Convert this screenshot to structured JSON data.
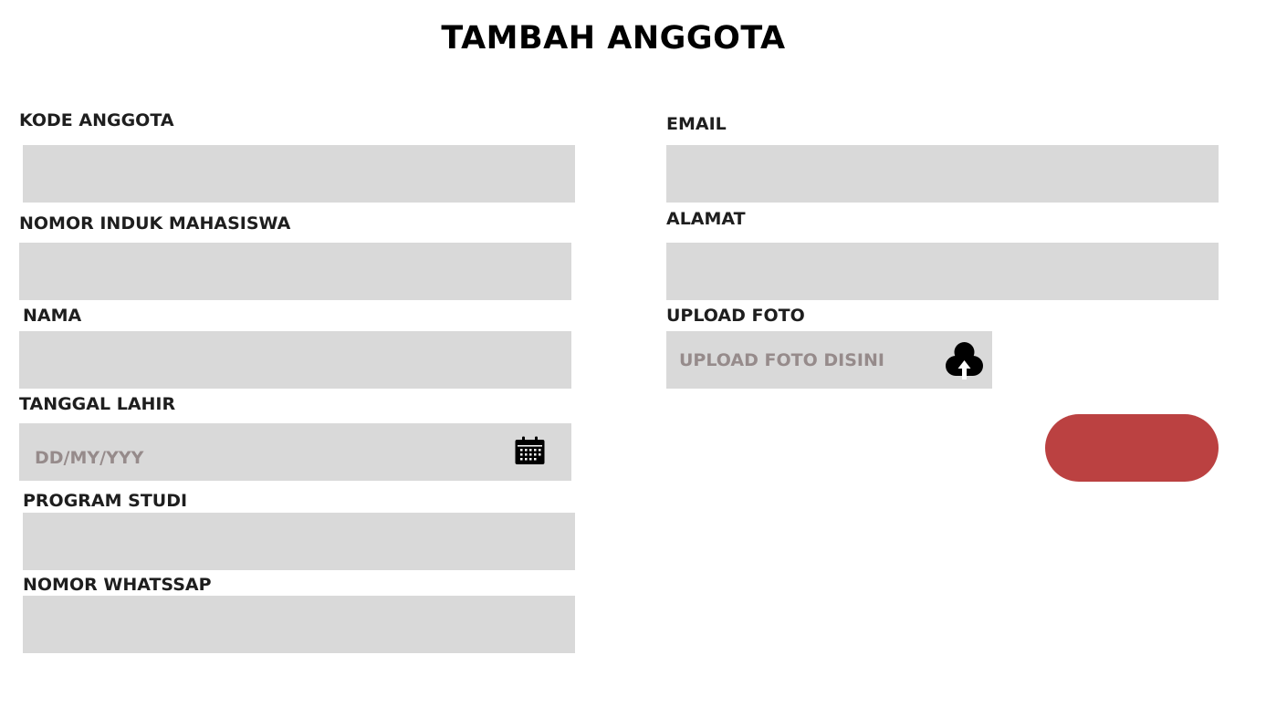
{
  "page_title": "TAMBAH ANGGOTA",
  "form": {
    "kode_anggota": {
      "label": "KODE ANGGOTA",
      "value": ""
    },
    "nim": {
      "label": "NOMOR INDUK MAHASISWA",
      "value": ""
    },
    "nama": {
      "label": "NAMA",
      "value": ""
    },
    "tanggal_lahir": {
      "label": "TANGGAL LAHIR",
      "placeholder": "DD/MY/YYY",
      "value": ""
    },
    "program_studi": {
      "label": "PROGRAM STUDI",
      "value": ""
    },
    "whatsapp": {
      "label": "NOMOR WHATSSAP",
      "value": ""
    },
    "email": {
      "label": "EMAIL",
      "value": ""
    },
    "alamat": {
      "label": "ALAMAT",
      "value": ""
    },
    "upload_foto": {
      "label": "UPLOAD FOTO",
      "placeholder": "UPLOAD FOTO DISINI"
    }
  },
  "submit_button": {
    "label": ""
  },
  "icons": {
    "calendar": "calendar-icon",
    "upload": "cloud-upload-icon"
  },
  "colors": {
    "field_background": "#d9d9d9",
    "placeholder_text": "#968b8b",
    "submit_button": "#bb4141",
    "title_text": "#000000"
  }
}
